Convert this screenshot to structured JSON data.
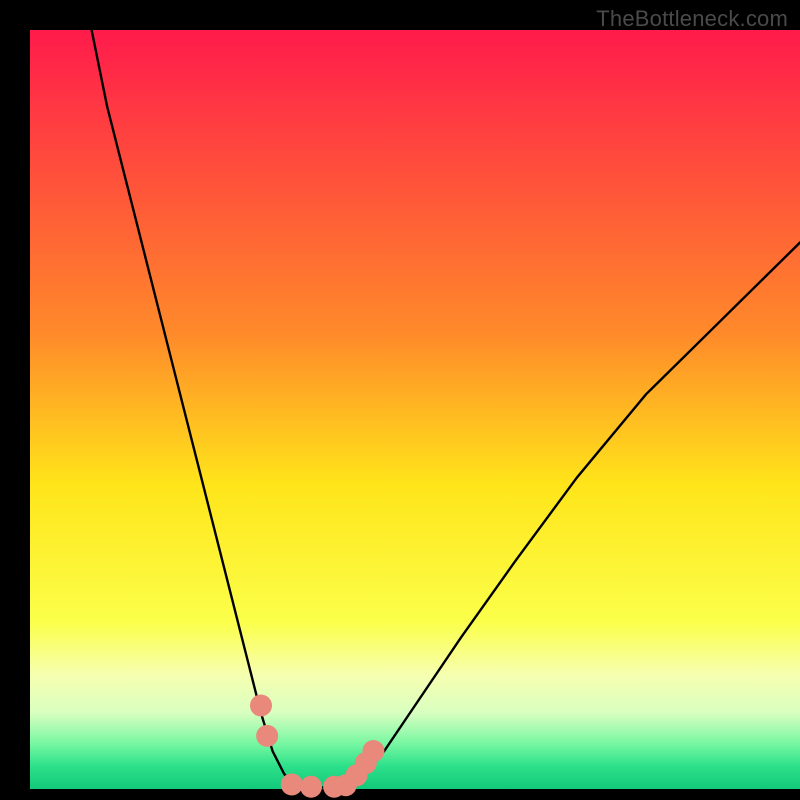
{
  "watermark": {
    "text": "TheBottleneck.com"
  },
  "chart_data": {
    "type": "line",
    "title": "",
    "xlabel": "",
    "ylabel": "",
    "xlim": [
      0,
      100
    ],
    "ylim": [
      0,
      100
    ],
    "grid": false,
    "legend": false,
    "background": {
      "gradient_stops": [
        {
          "offset": 0.0,
          "color": "#ff1b4b"
        },
        {
          "offset": 0.4,
          "color": "#ff8a2a"
        },
        {
          "offset": 0.6,
          "color": "#ffe51a"
        },
        {
          "offset": 0.78,
          "color": "#fbff4a"
        },
        {
          "offset": 0.85,
          "color": "#f6ffb0"
        },
        {
          "offset": 0.9,
          "color": "#d8ffc0"
        },
        {
          "offset": 0.94,
          "color": "#78f7a2"
        },
        {
          "offset": 0.97,
          "color": "#2de08a"
        },
        {
          "offset": 1.0,
          "color": "#12c97a"
        }
      ]
    },
    "series": [
      {
        "name": "left-curve",
        "stroke": "#000000",
        "x": [
          8,
          10,
          13,
          16,
          19,
          22,
          25,
          28,
          30,
          31.5,
          33,
          34,
          34.5
        ],
        "y": [
          100,
          90,
          78,
          66,
          54,
          42,
          30,
          18,
          10,
          5,
          2,
          0.8,
          0.2
        ]
      },
      {
        "name": "right-curve",
        "stroke": "#000000",
        "x": [
          41,
          42,
          43.5,
          46,
          50,
          56,
          63,
          71,
          80,
          90,
          100
        ],
        "y": [
          0.2,
          0.8,
          2,
          5,
          11,
          20,
          30,
          41,
          52,
          62,
          72
        ]
      },
      {
        "name": "flat-bottom",
        "stroke": "#000000",
        "x": [
          34.5,
          41
        ],
        "y": [
          0.2,
          0.2
        ]
      }
    ],
    "markers": [
      {
        "x": 30.0,
        "y": 11.0
      },
      {
        "x": 30.8,
        "y": 7.0
      },
      {
        "x": 34.0,
        "y": 0.6
      },
      {
        "x": 36.5,
        "y": 0.3
      },
      {
        "x": 39.5,
        "y": 0.3
      },
      {
        "x": 41.0,
        "y": 0.5
      },
      {
        "x": 42.4,
        "y": 1.8
      },
      {
        "x": 43.6,
        "y": 3.4
      },
      {
        "x": 44.6,
        "y": 5.0
      }
    ],
    "marker_style": {
      "color": "#e8897b",
      "r": 11
    }
  }
}
